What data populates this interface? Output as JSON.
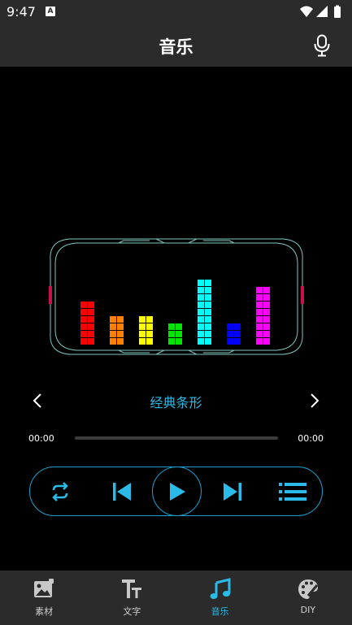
{
  "status_bar": {
    "time": "9:47",
    "notification_glyph": "A"
  },
  "header": {
    "title": "音乐",
    "mic_icon": "microphone-icon"
  },
  "visualizer": {
    "frame_color": "#7fc8c0",
    "bars": [
      {
        "level": 6,
        "color": "#ff0000"
      },
      {
        "level": 4,
        "color": "#ff7f00"
      },
      {
        "level": 4,
        "color": "#ffff00"
      },
      {
        "level": 3,
        "color": "#00e600"
      },
      {
        "level": 9,
        "color": "#00ffff"
      },
      {
        "level": 3,
        "color": "#0000ff"
      },
      {
        "level": 8,
        "color": "#ff00ff"
      }
    ]
  },
  "style_selector": {
    "name": "经典条形"
  },
  "player": {
    "current_time": "00:00",
    "total_time": "00:00",
    "progress": 0
  },
  "controls": {
    "items": [
      "repeat-icon",
      "previous-icon",
      "play-icon",
      "next-icon",
      "playlist-icon"
    ]
  },
  "nav": {
    "items": [
      {
        "label": "素材",
        "icon": "image-icon",
        "active": false
      },
      {
        "label": "文字",
        "icon": "text-icon",
        "active": false
      },
      {
        "label": "音乐",
        "icon": "music-note-icon",
        "active": true
      },
      {
        "label": "DIY",
        "icon": "palette-icon",
        "active": false
      }
    ]
  },
  "colors": {
    "accent": "#2bbbe8",
    "bar_background": "#2b2b2b"
  }
}
